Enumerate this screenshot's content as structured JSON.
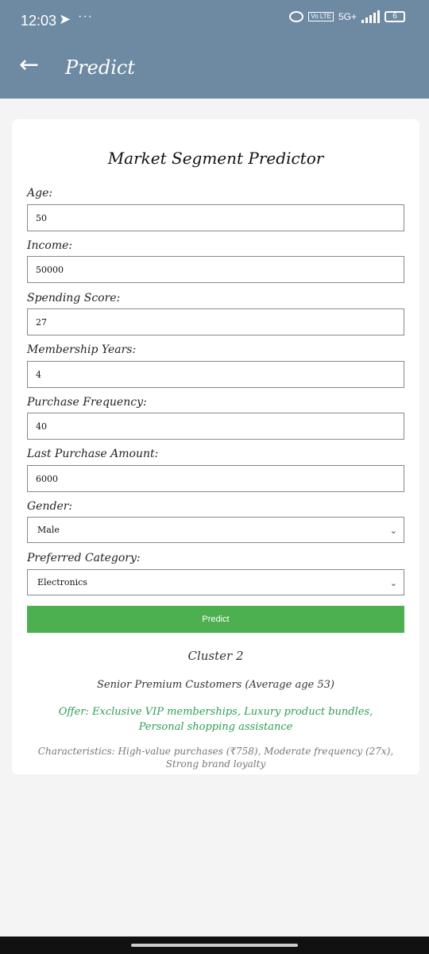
{
  "status_bar": {
    "time": "12:03",
    "send_icon": "telegram-send-icon",
    "dots": "···",
    "network": "5G+",
    "volte": "Vo LTE",
    "battery": "6"
  },
  "app_bar": {
    "back_icon": "←",
    "title": "Predict"
  },
  "form": {
    "title": "Market Segment Predictor",
    "fields": [
      {
        "label": "Age:",
        "value": "50"
      },
      {
        "label": "Income:",
        "value": "50000"
      },
      {
        "label": "Spending Score:",
        "value": "27"
      },
      {
        "label": "Membership Years:",
        "value": "4"
      },
      {
        "label": "Purchase Frequency:",
        "value": "40"
      },
      {
        "label": "Last Purchase Amount:",
        "value": "6000"
      }
    ],
    "gender": {
      "label": "Gender:",
      "value": "Male"
    },
    "category": {
      "label": "Preferred Category:",
      "value": "Electronics"
    },
    "submit_label": "Predict"
  },
  "result": {
    "cluster": "Cluster 2",
    "segment": "Senior Premium Customers (Average age 53)",
    "offer": "Offer: Exclusive VIP memberships, Luxury product bundles, Personal shopping assistance",
    "characteristics": "Characteristics: High-value purchases (₹758), Moderate frequency (27x), Strong brand loyalty"
  },
  "colors": {
    "app_bar": "#6e8aa3",
    "button": "#4cb050",
    "offer_text": "#2e9e52"
  }
}
